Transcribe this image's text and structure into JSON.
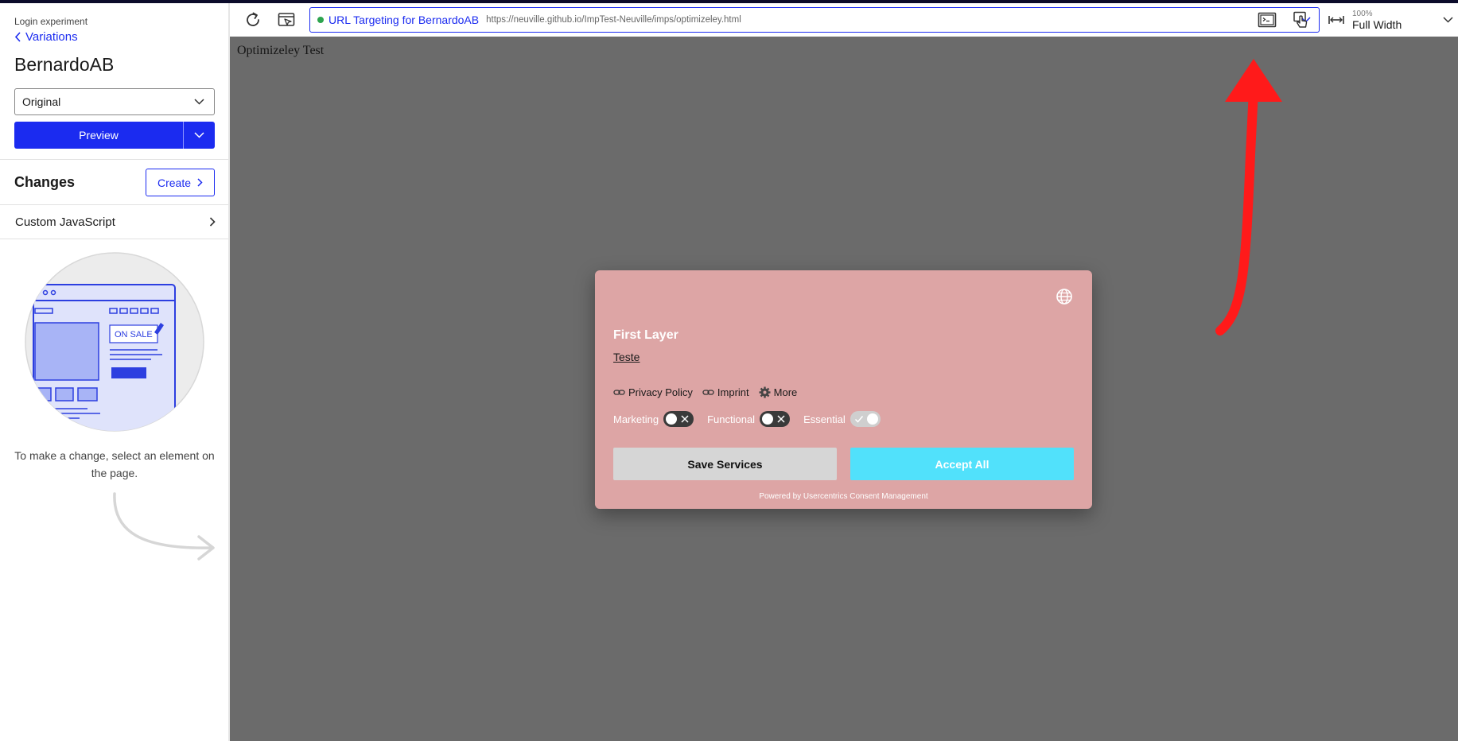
{
  "sidebar": {
    "kicker": "Login experiment",
    "back_label": "Variations",
    "title": "BernardoAB",
    "variation_select": {
      "value": "Original"
    },
    "preview_label": "Preview",
    "changes": {
      "title": "Changes",
      "create_label": "Create",
      "items": [
        {
          "label": "Custom JavaScript"
        }
      ]
    },
    "illustration_label": "ON SALE",
    "empty_message": "To make a change, select an element on the page."
  },
  "toolbar": {
    "url_targeting_name": "URL Targeting for BernardoAB",
    "url": "https://neuville.github.io/ImpTest-Neuville/imps/optimizeley.html",
    "zoom_percent": "100%",
    "zoom_mode": "Full Width",
    "status_color": "#2da44e"
  },
  "canvas": {
    "page_text": "Optimizeley Test"
  },
  "consent_modal": {
    "title": "First Layer",
    "description_link": "Teste",
    "links": [
      {
        "label": "Privacy Policy",
        "icon": "link-icon"
      },
      {
        "label": "Imprint",
        "icon": "link-icon"
      },
      {
        "label": "More",
        "icon": "gear-icon"
      }
    ],
    "toggles": [
      {
        "label": "Marketing",
        "state": "off"
      },
      {
        "label": "Functional",
        "state": "off"
      },
      {
        "label": "Essential",
        "state": "on"
      }
    ],
    "save_label": "Save Services",
    "accept_label": "Accept All",
    "powered_by": "Powered by Usercentrics Consent Management",
    "background_color": "#dda5a5",
    "accept_color": "#51e1fb"
  },
  "colors": {
    "accent": "#1b2bf0",
    "canvas_bg": "#6b6b6b",
    "annotation_arrow": "#ff1a1a"
  }
}
